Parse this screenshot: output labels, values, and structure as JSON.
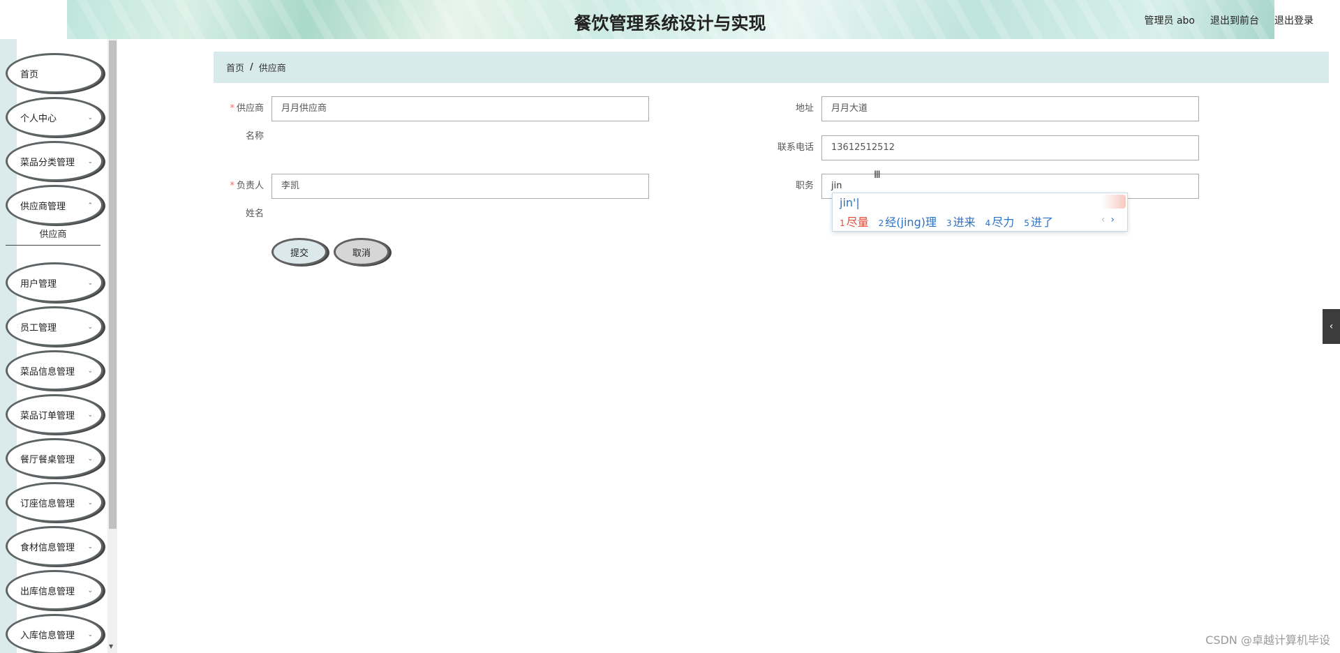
{
  "header": {
    "title": "餐饮管理系统设计与实现",
    "user_label": "管理员 abo",
    "front_label": "退出到前台",
    "logout_label": "退出登录"
  },
  "sidebar": {
    "items": [
      {
        "label": "首页"
      },
      {
        "label": "个人中心"
      },
      {
        "label": "菜品分类管理"
      },
      {
        "label": "供应商管理"
      },
      {
        "label": "用户管理"
      },
      {
        "label": "员工管理"
      },
      {
        "label": "菜品信息管理"
      },
      {
        "label": "菜品订单管理"
      },
      {
        "label": "餐厅餐桌管理"
      },
      {
        "label": "订座信息管理"
      },
      {
        "label": "食材信息管理"
      },
      {
        "label": "出库信息管理"
      },
      {
        "label": "入库信息管理"
      }
    ],
    "submenu_label": "供应商"
  },
  "breadcrumb": {
    "home": "首页",
    "separator": "/",
    "current": "供应商"
  },
  "form": {
    "supplier_name_label": "供应商",
    "supplier_name_label2": "名称",
    "supplier_name_value": "月月供应商",
    "person_label": "负责人",
    "person_label2": "姓名",
    "person_value": "李凯",
    "address_label": "地址",
    "address_value": "月月大道",
    "phone_label": "联系电话",
    "phone_value": "13612512512",
    "position_label": "职务",
    "position_value": "jin",
    "submit_label": "提交",
    "cancel_label": "取消",
    "required_mark": "*"
  },
  "ime": {
    "composition": "jin'|",
    "candidates": [
      {
        "num": "1",
        "text": "尽量"
      },
      {
        "num": "2",
        "text": "经(jing)理"
      },
      {
        "num": "3",
        "text": "进来"
      },
      {
        "num": "4",
        "text": "尽力"
      },
      {
        "num": "5",
        "text": "进了"
      }
    ],
    "prev": "‹",
    "next": "›"
  },
  "watermark": "CSDN @卓越计算机毕设",
  "side_tab_glyph": "‹"
}
